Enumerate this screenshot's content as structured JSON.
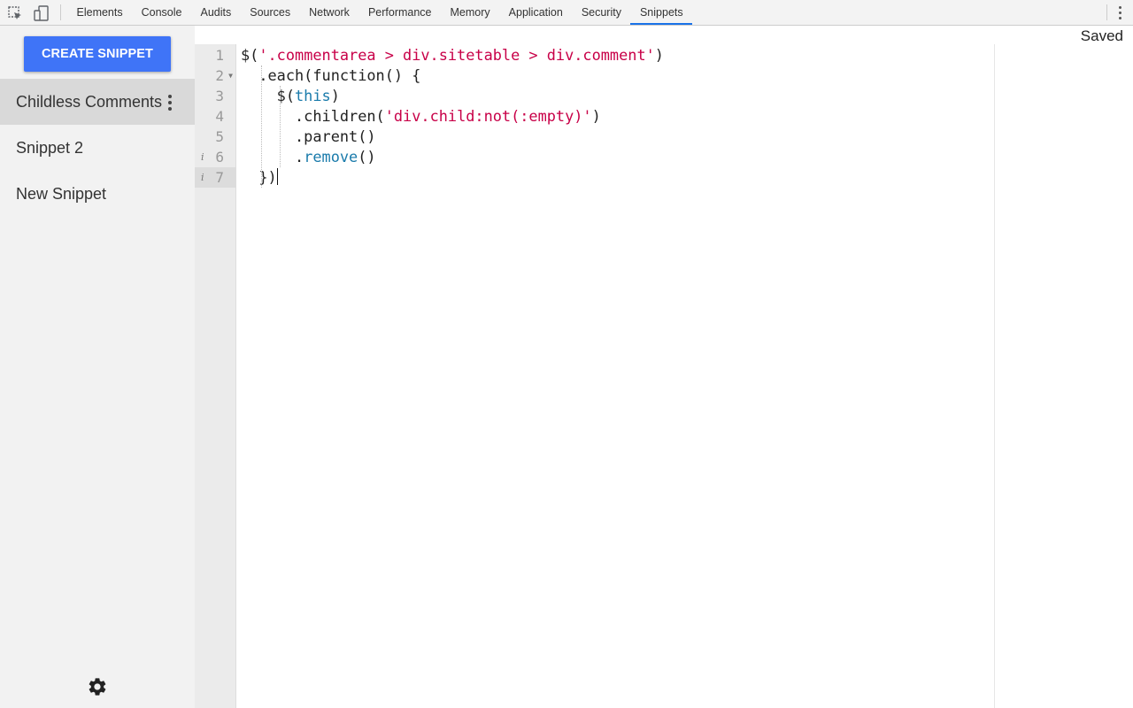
{
  "toolbar": {
    "inspect_icon": "inspect-element-icon",
    "device_icon": "device-toolbar-icon",
    "tabs": [
      "Elements",
      "Console",
      "Audits",
      "Sources",
      "Network",
      "Performance",
      "Memory",
      "Application",
      "Security",
      "Snippets"
    ],
    "active_tab": "Snippets",
    "menu_icon": "kebab-menu-icon"
  },
  "sidebar": {
    "create_label": "CREATE SNIPPET",
    "items": [
      {
        "label": "Childless Comments",
        "active": true
      },
      {
        "label": "Snippet 2",
        "active": false
      },
      {
        "label": "New Snippet",
        "active": false
      }
    ],
    "settings_icon": "gear-icon"
  },
  "status": {
    "saved": "Saved"
  },
  "editor": {
    "line_numbers": [
      "1",
      "2",
      "3",
      "4",
      "5",
      "6",
      "7"
    ],
    "lines": [
      "$('.commentarea > div.sitetable > div.comment')",
      "  .each(function() {",
      "    $(this)",
      "      .children('div.child:not(:empty)')",
      "      .parent()",
      "      .remove()",
      "  })"
    ],
    "info_markers": [
      "i",
      "i"
    ]
  },
  "colors": {
    "accent": "#3f74f7",
    "string": "#c80048",
    "keyword": "#1a7bab"
  }
}
